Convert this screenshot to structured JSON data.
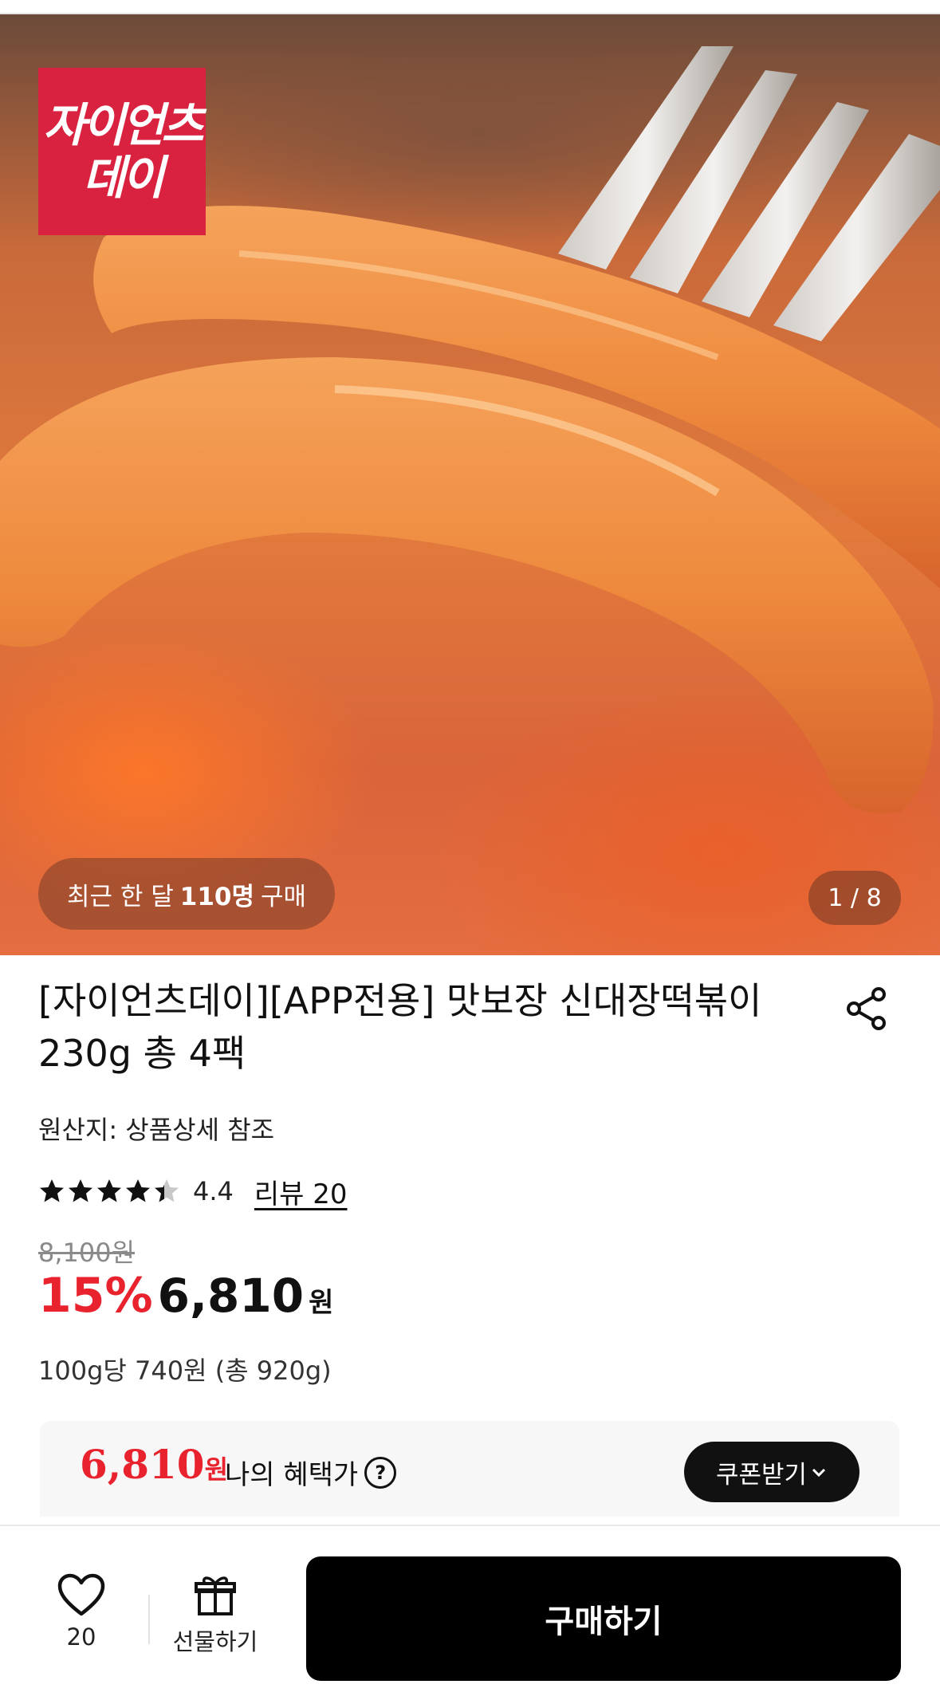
{
  "brand": {
    "logo_line1": "자이언츠",
    "logo_line2": "데이",
    "brand_color": "#d9223f"
  },
  "hero": {
    "recent_prefix": "최근 한 달",
    "recent_count": "110명",
    "recent_suffix": "구매",
    "page_counter": "1 / 8"
  },
  "product": {
    "title": "[자이언츠데이][APP전용] 맛보장 신대장떡볶이 230g 총 4팩",
    "origin": "원산지: 상품상세 참조",
    "rating": "4.4",
    "rating_value": 4.4,
    "rating_max": 5,
    "review_label": "리뷰 20",
    "original_price": "8,100원",
    "discount": "15%",
    "sale_price": "6,810",
    "sale_price_unit": "원",
    "unit_price": "100g당 740원 (총 920g)"
  },
  "benefit": {
    "price": "6,810",
    "price_unit": "원",
    "label": "나의 혜택가",
    "help_icon": "?",
    "coupon_button": "쿠폰받기",
    "accent_color": "#e8232e"
  },
  "bottom_bar": {
    "wish_count": "20",
    "gift_label": "선물하기",
    "buy_label": "구매하기"
  },
  "icons": [
    "heart-icon",
    "gift-icon",
    "share-icon",
    "star-icon",
    "question-icon",
    "chevron-down-icon"
  ]
}
